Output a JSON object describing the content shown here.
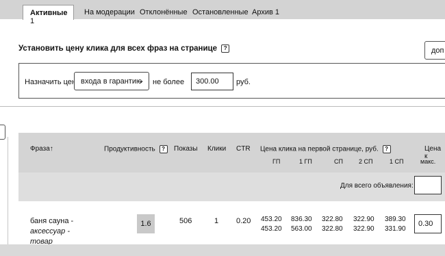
{
  "tabs": [
    {
      "label": "Активные",
      "count": "1"
    },
    {
      "label": "На модерации"
    },
    {
      "label": "Отклонённые"
    },
    {
      "label": "Остановленные"
    },
    {
      "label": "Архив",
      "count": "1"
    }
  ],
  "section_title": "Установить цену клика для всех фраз на странице",
  "help_glyph": "?",
  "top_button_label": "доп",
  "price_form": {
    "assign_label": "Назначить цену",
    "mode_value": "входа в гарантию",
    "limit_label": "не более",
    "max_value": "300.00",
    "currency": "руб."
  },
  "table": {
    "headers": {
      "phrase": "Фраза",
      "productivity": "Продуктивность",
      "impressions": "Показы",
      "clicks": "Клики",
      "ctr": "CTR",
      "first_page_price": "Цена клика на первой странице, руб.",
      "price_cut": "Цена к",
      "max_sub": "макс."
    },
    "sub_headers": [
      "ГП",
      "1 ГП",
      "СП",
      "2 СП",
      "1 СП"
    ],
    "all_ads_label": "Для всего объявления:",
    "rows": [
      {
        "phrase_main": "баня сауна  -",
        "phrase_italic_1": "аксессуар -",
        "phrase_italic_2": "товар",
        "productivity": "1.6",
        "impressions": "506",
        "clicks": "1",
        "ctr": "0.20",
        "prices_top": [
          "453.20",
          "836.30",
          "322.80",
          "322.90",
          "389.30"
        ],
        "prices_bottom": [
          "453.20",
          "563.00",
          "322.80",
          "322.90",
          "331.90"
        ],
        "max_price": "0.30"
      }
    ]
  }
}
